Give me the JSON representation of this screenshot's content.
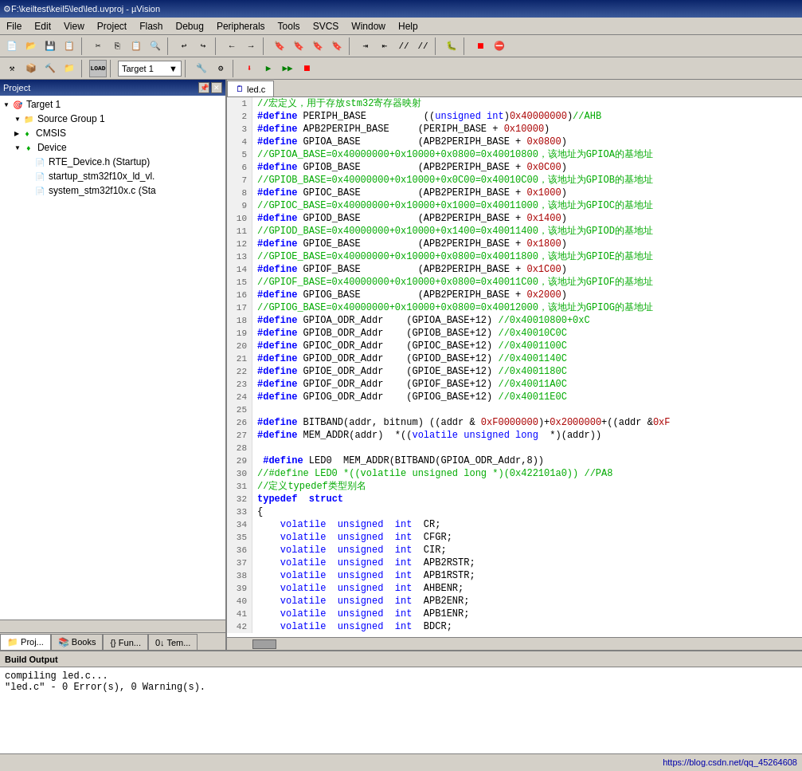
{
  "titleBar": {
    "title": "F:\\keiltest\\keil5\\led\\led.uvproj - µVision"
  },
  "menuBar": {
    "items": [
      "File",
      "Edit",
      "View",
      "Project",
      "Flash",
      "Debug",
      "Peripherals",
      "Tools",
      "SVCS",
      "Window",
      "Help"
    ]
  },
  "toolbar": {
    "target_dropdown": "Target 1"
  },
  "projectPanel": {
    "header": "Project",
    "tree": [
      {
        "level": 0,
        "label": "Target 1",
        "type": "target",
        "expanded": true
      },
      {
        "level": 1,
        "label": "Source Group 1",
        "type": "folder",
        "expanded": true
      },
      {
        "level": 1,
        "label": "CMSIS",
        "type": "diamond",
        "expanded": false
      },
      {
        "level": 1,
        "label": "Device",
        "type": "diamond",
        "expanded": true
      },
      {
        "level": 2,
        "label": "RTE_Device.h (Startup)",
        "type": "file"
      },
      {
        "level": 2,
        "label": "startup_stm32f10x_ld_vl.",
        "type": "file"
      },
      {
        "level": 2,
        "label": "system_stm32f10x.c (Sta",
        "type": "file"
      }
    ],
    "tabs": [
      "Proj...",
      "Books",
      "{} Fun...",
      "0↓ Tem..."
    ]
  },
  "codeTab": {
    "filename": "led.c"
  },
  "codeLines": [
    {
      "num": 1,
      "text": "//宏定义，用于存放stm32寄存器映射",
      "type": "comment"
    },
    {
      "num": 2,
      "text": "#define PERIPH_BASE          ((unsigned int)0x40000000)//AHB",
      "type": "define"
    },
    {
      "num": 3,
      "text": "#define APB2PERIPH_BASE     (PERIPH_BASE + 0x10000)",
      "type": "define"
    },
    {
      "num": 4,
      "text": "#define GPIOA_BASE          (APB2PERIPH_BASE + 0x0800)",
      "type": "define"
    },
    {
      "num": 5,
      "text": "//GPIOA_BASE=0x40000000+0x10000+0x0800=0x40010800，该地址为GPIOA的基地址",
      "type": "comment"
    },
    {
      "num": 6,
      "text": "#define GPIOB_BASE          (APB2PERIPH_BASE + 0x0C00)",
      "type": "define"
    },
    {
      "num": 7,
      "text": "//GPIOB_BASE=0x40000000+0x10000+0x0C00=0x40010C00，该地址为GPIOB的基地址",
      "type": "comment"
    },
    {
      "num": 8,
      "text": "#define GPIOC_BASE          (APB2PERIPH_BASE + 0x1000)",
      "type": "define"
    },
    {
      "num": 9,
      "text": "//GPIOC_BASE=0x40000000+0x10000+0x1000=0x40011000，该地址为GPIOC的基地址",
      "type": "comment"
    },
    {
      "num": 10,
      "text": "#define GPIOD_BASE          (APB2PERIPH_BASE + 0x1400)",
      "type": "define"
    },
    {
      "num": 11,
      "text": "//GPIOD_BASE=0x40000000+0x10000+0x1400=0x40011400，该地址为GPIOD的基地址",
      "type": "comment"
    },
    {
      "num": 12,
      "text": "#define GPIOE_BASE          (APB2PERIPH_BASE + 0x1800)",
      "type": "define"
    },
    {
      "num": 13,
      "text": "//GPIOE_BASE=0x40000000+0x10000+0x0800=0x40011800，该地址为GPIOE的基地址",
      "type": "comment"
    },
    {
      "num": 14,
      "text": "#define GPIOF_BASE          (APB2PERIPH_BASE + 0x1C00)",
      "type": "define"
    },
    {
      "num": 15,
      "text": "//GPIOF_BASE=0x40000000+0x10000+0x0800=0x40011C00，该地址为GPIOF的基地址",
      "type": "comment"
    },
    {
      "num": 16,
      "text": "#define GPIOG_BASE          (APB2PERIPH_BASE + 0x2000)",
      "type": "define"
    },
    {
      "num": 17,
      "text": "//GPIOG_BASE=0x40000000+0x10000+0x0800=0x40012000，该地址为GPIOG的基地址",
      "type": "comment"
    },
    {
      "num": 18,
      "text": "#define GPIOA_ODR_Addr    (GPIOA_BASE+12) //0x40010800+0xC",
      "type": "define"
    },
    {
      "num": 19,
      "text": "#define GPIOB_ODR_Addr    (GPIOB_BASE+12) //0x40010C0C",
      "type": "define"
    },
    {
      "num": 20,
      "text": "#define GPIOC_ODR_Addr    (GPIOC_BASE+12) //0x4001100C",
      "type": "define"
    },
    {
      "num": 21,
      "text": "#define GPIOD_ODR_Addr    (GPIOD_BASE+12) //0x4001140C",
      "type": "define"
    },
    {
      "num": 22,
      "text": "#define GPIOE_ODR_Addr    (GPIOE_BASE+12) //0x4001180C",
      "type": "define"
    },
    {
      "num": 23,
      "text": "#define GPIOF_ODR_Addr    (GPIOF_BASE+12) //0x40011A0C",
      "type": "define"
    },
    {
      "num": 24,
      "text": "#define GPIOG_ODR_Addr    (GPIOG_BASE+12) //0x40011E0C",
      "type": "define"
    },
    {
      "num": 25,
      "text": "",
      "type": "blank"
    },
    {
      "num": 26,
      "text": "#define BITBAND(addr, bitnum) ((addr & 0xF0000000)+0x2000000+((addr &0xF",
      "type": "define"
    },
    {
      "num": 27,
      "text": "#define MEM_ADDR(addr)  *((volatile unsigned long  *)(addr))",
      "type": "define"
    },
    {
      "num": 28,
      "text": "",
      "type": "blank"
    },
    {
      "num": 29,
      "text": " #define LED0  MEM_ADDR(BITBAND(GPIOA_ODR_Addr,8))",
      "type": "define"
    },
    {
      "num": 30,
      "text": "//# define LED0  *((volatile unsigned long *)(0x422101a0)) //PA8",
      "type": "comment"
    },
    {
      "num": 31,
      "text": "//定义typedef类型别名",
      "type": "comment"
    },
    {
      "num": 32,
      "text": "typedef  struct",
      "type": "typedef"
    },
    {
      "num": 33,
      "text": "{",
      "type": "brace"
    },
    {
      "num": 34,
      "text": "    volatile  unsigned  int  CR;",
      "type": "volatile"
    },
    {
      "num": 35,
      "text": "    volatile  unsigned  int  CFGR;",
      "type": "volatile"
    },
    {
      "num": 36,
      "text": "    volatile  unsigned  int  CIR;",
      "type": "volatile"
    },
    {
      "num": 37,
      "text": "    volatile  unsigned  int  APB2RSTR;",
      "type": "volatile"
    },
    {
      "num": 38,
      "text": "    volatile  unsigned  int  APB1RSTR;",
      "type": "volatile"
    },
    {
      "num": 39,
      "text": "    volatile  unsigned  int  AHBENR;",
      "type": "volatile"
    },
    {
      "num": 40,
      "text": "    volatile  unsigned  int  APB2ENR;",
      "type": "volatile"
    },
    {
      "num": 41,
      "text": "    volatile  unsigned  int  APB1ENR;",
      "type": "volatile"
    },
    {
      "num": 42,
      "text": "    volatile  unsigned  int  BDCR;",
      "type": "volatile"
    }
  ],
  "buildOutput": {
    "header": "Build Output",
    "lines": [
      "compiling led.c...",
      "\"led.c\" - 0 Error(s), 0 Warning(s)."
    ]
  },
  "statusBar": {
    "left": "",
    "right": "https://blog.csdn.net/qq_45264608"
  }
}
